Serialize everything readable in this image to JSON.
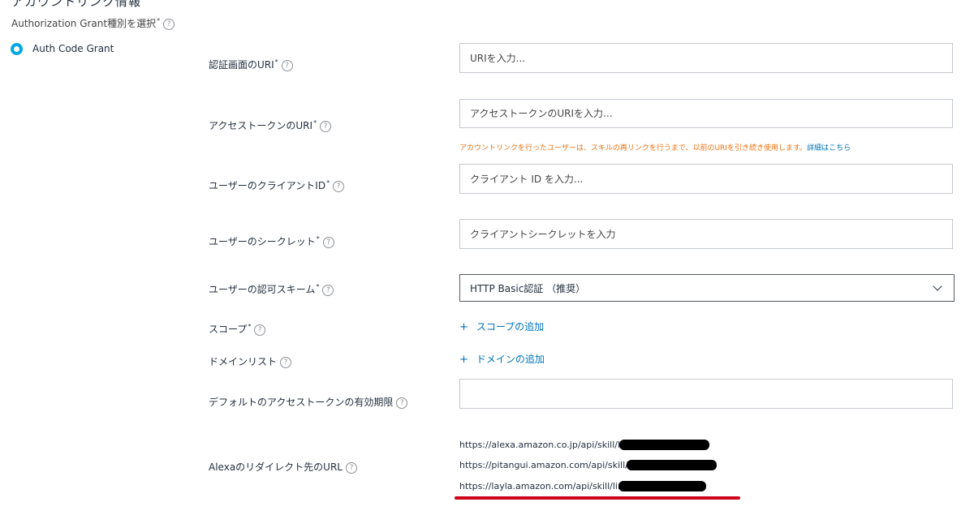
{
  "header": {
    "section_title": "アカウントリンク情報",
    "grant_select_label": "Authorization Grant種別を選択",
    "grant_option": "Auth Code Grant"
  },
  "fields": {
    "auth_uri": {
      "label": "認証画面のURI",
      "placeholder": "URIを入力..."
    },
    "token_uri": {
      "label": "アクセストークンのURI",
      "placeholder": "アクセストークンのURIを入力..."
    },
    "token_warning": "アカウントリンクを行ったユーザーは、スキルの再リンクを行うまで、以前のURIを引き続き使用します。",
    "token_warning_link": "詳細はこちら",
    "client_id": {
      "label": "ユーザーのクライアントID",
      "placeholder": "クライアント ID を入力..."
    },
    "client_secret": {
      "label": "ユーザーのシークレット",
      "placeholder": "クライアントシークレットを入力"
    },
    "auth_scheme": {
      "label": "ユーザーの認可スキーム",
      "value": "HTTP Basic認証 （推奨）"
    },
    "scope": {
      "label": "スコープ",
      "add_label": "スコープの追加"
    },
    "domain": {
      "label": "ドメインリスト",
      "add_label": "ドメインの追加"
    },
    "default_expiry": {
      "label": "デフォルトのアクセストークンの有効期限",
      "value": ""
    },
    "redirect": {
      "label": "Alexaのリダイレクト先のURL",
      "urls": [
        "https://alexa.amazon.co.jp/api/skill/link",
        "https://pitangui.amazon.com/api/skill/lin",
        "https://layla.amazon.com/api/skill/link"
      ]
    }
  },
  "icons": {
    "help": "question-circle-icon",
    "add": "plus-icon",
    "dropdown": "chevron-down-icon"
  },
  "colors": {
    "radio": "#00a8e1",
    "link": "#0073bb",
    "warning": "#ec7211",
    "annotation": "#d0021b"
  }
}
